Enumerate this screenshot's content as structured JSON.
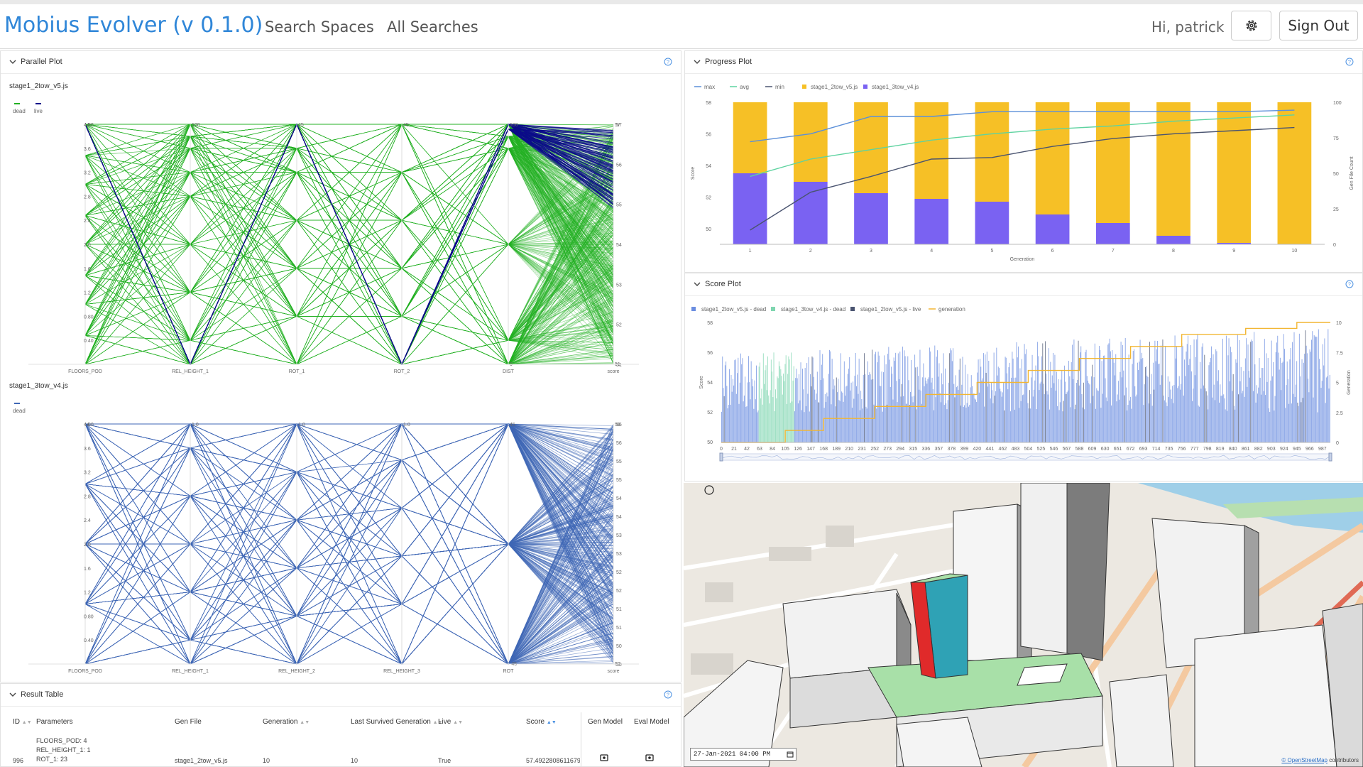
{
  "header": {
    "app_title": "Mobius Evolver (v 0.1.0)",
    "nav": [
      "Search Spaces",
      "All Searches"
    ],
    "greeting": "Hi, patrick",
    "settings_icon": "gear-icon",
    "sign_out_label": "Sign Out"
  },
  "parallel_plot": {
    "title": "Parallel Plot",
    "charts": [
      {
        "name": "stage1_2tow_v5.js",
        "legend": [
          {
            "label": "dead",
            "color": "#22b022"
          },
          {
            "label": "live",
            "color": "#0b0b8a"
          }
        ],
        "axes": [
          "FLOORS_POD",
          "REL_HEIGHT_1",
          "ROT_1",
          "ROT_2",
          "DIST",
          "score"
        ],
        "first_axis_ticks": [
          "4.0",
          "3.6",
          "3.2",
          "2.8",
          "2.4",
          "2.0",
          "1.6",
          "1.2",
          "0.80",
          "0.40"
        ],
        "axis_max": [
          "4.0",
          "100",
          "45",
          "45",
          "100",
          "57"
        ],
        "axis_min": [
          "",
          "",
          "",
          "",
          "0",
          "51"
        ],
        "score_ticks": [
          "57",
          "56",
          "55",
          "54",
          "53",
          "52",
          "51"
        ]
      },
      {
        "name": "stage1_3tow_v4.js",
        "legend": [
          {
            "label": "dead",
            "color": "#3f67b5"
          }
        ],
        "axes": [
          "FLOORS_POD",
          "REL_HEIGHT_1",
          "REL_HEIGHT_2",
          "REL_HEIGHT_3",
          "ROT",
          "score"
        ],
        "first_axis_ticks": [
          "4.0",
          "3.6",
          "3.2",
          "2.8",
          "2.4",
          "2.0",
          "1.6",
          "1.2",
          "0.80",
          "0.40"
        ],
        "axis_max": [
          "4.0",
          "1.0",
          "1.0",
          "1.0",
          "45",
          "56"
        ],
        "axis_min": [
          "",
          "",
          "",
          "",
          "-45",
          "50"
        ],
        "score_ticks": [
          "56",
          "56",
          "55",
          "55",
          "54",
          "54",
          "53",
          "53",
          "52",
          "52",
          "51",
          "51",
          "50",
          "50"
        ]
      }
    ]
  },
  "progress_plot": {
    "title": "Progress Plot",
    "legend": [
      {
        "label": "max",
        "color": "#5b8fd9",
        "kind": "line"
      },
      {
        "label": "avg",
        "color": "#5ed3a0",
        "kind": "line"
      },
      {
        "label": "min",
        "color": "#4a5470",
        "kind": "line"
      },
      {
        "label": "stage1_2tow_v5.js",
        "color": "#f6c026",
        "kind": "box"
      },
      {
        "label": "stage1_3tow_v4.js",
        "color": "#7a62f2",
        "kind": "box"
      }
    ],
    "xlabel": "Generation",
    "ylabel_left": "Score",
    "ylabel_right": "Gen File Count",
    "y_ticks_left": [
      "58",
      "56",
      "54",
      "52",
      "50"
    ],
    "y_ticks_right": [
      "100",
      "75",
      "50",
      "25",
      "0"
    ]
  },
  "score_plot": {
    "title": "Score Plot",
    "legend": [
      {
        "label": "stage1_2tow_v5.js - dead",
        "color": "#6b8de0",
        "kind": "box"
      },
      {
        "label": "stage1_3tow_v4.js - dead",
        "color": "#7fd6b0",
        "kind": "box"
      },
      {
        "label": "stage1_2tow_v5.js - live",
        "color": "#4a5470",
        "kind": "box"
      },
      {
        "label": "generation",
        "color": "#f2b632",
        "kind": "line"
      }
    ],
    "ylabel_left": "Score",
    "ylabel_right": "Generation",
    "y_ticks_left": [
      "58",
      "56",
      "54",
      "52",
      "50"
    ],
    "y_ticks_right": [
      "10",
      "7.5",
      "5",
      "2.5",
      "0"
    ],
    "x_ticks": [
      "0",
      "21",
      "42",
      "63",
      "84",
      "105",
      "126",
      "147",
      "168",
      "189",
      "210",
      "231",
      "252",
      "273",
      "294",
      "315",
      "336",
      "357",
      "378",
      "399",
      "420",
      "441",
      "462",
      "483",
      "504",
      "525",
      "546",
      "567",
      "588",
      "609",
      "630",
      "651",
      "672",
      "693",
      "714",
      "735",
      "756",
      "777",
      "798",
      "819",
      "840",
      "861",
      "882",
      "903",
      "924",
      "945",
      "966",
      "987"
    ]
  },
  "chart_data": [
    {
      "type": "bar",
      "title": "Progress Plot",
      "xlabel": "Generation",
      "ylabel": "Gen File Count",
      "categories": [
        "1",
        "2",
        "3",
        "4",
        "5",
        "6",
        "7",
        "8",
        "9",
        "10"
      ],
      "ylim": [
        0,
        100
      ],
      "series": [
        {
          "name": "stage1_3tow_v4.js",
          "values": [
            50,
            44,
            36,
            32,
            30,
            21,
            15,
            6,
            1,
            0
          ]
        },
        {
          "name": "stage1_2tow_v5.js",
          "values": [
            50,
            56,
            64,
            68,
            70,
            79,
            85,
            94,
            99,
            100
          ]
        }
      ]
    },
    {
      "type": "line",
      "title": "Progress Plot",
      "xlabel": "Generation",
      "ylabel": "Score",
      "x": [
        1,
        2,
        3,
        4,
        5,
        6,
        7,
        8,
        9,
        10
      ],
      "ylim": [
        49,
        58
      ],
      "series": [
        {
          "name": "max",
          "values": [
            55.5,
            56.0,
            57.1,
            57.1,
            57.4,
            57.4,
            57.4,
            57.4,
            57.4,
            57.5
          ]
        },
        {
          "name": "avg",
          "values": [
            53.3,
            54.4,
            55.0,
            55.6,
            56.0,
            56.3,
            56.5,
            56.8,
            57.0,
            57.2
          ]
        },
        {
          "name": "min",
          "values": [
            49.9,
            52.3,
            53.3,
            54.4,
            54.5,
            55.2,
            55.7,
            56.0,
            56.2,
            56.4
          ]
        }
      ]
    },
    {
      "type": "line",
      "title": "Score Plot",
      "ylabel": "Generation",
      "x": [
        0,
        84,
        105,
        168,
        252,
        336,
        420,
        504,
        588,
        672,
        756,
        861,
        945,
        1000
      ],
      "ylim": [
        0,
        10
      ],
      "series": [
        {
          "name": "generation",
          "values": [
            0,
            0,
            1,
            2,
            3,
            4,
            5,
            6,
            7,
            8,
            9,
            9.5,
            10,
            10
          ]
        }
      ]
    }
  ],
  "result_table": {
    "title": "Result Table",
    "columns": [
      "ID",
      "Parameters",
      "Gen File",
      "Generation",
      "Last Survived Generation",
      "Live",
      "Score",
      "Gen Model",
      "Eval Model"
    ],
    "rows": [
      {
        "id": "996",
        "params": [
          "FLOORS_POD: 4",
          "REL_HEIGHT_1: 1",
          "ROT_1: 23"
        ],
        "gen_file": "stage1_2tow_v5.js",
        "generation": "10",
        "last_survived": "10",
        "live": "True",
        "score": "57.49228086116794"
      }
    ]
  },
  "map_view": {
    "date_value": "27-Jan-2021 04:00 PM",
    "attribution_link": "© OpenStreetMap",
    "attribution_suffix": "contributors"
  }
}
